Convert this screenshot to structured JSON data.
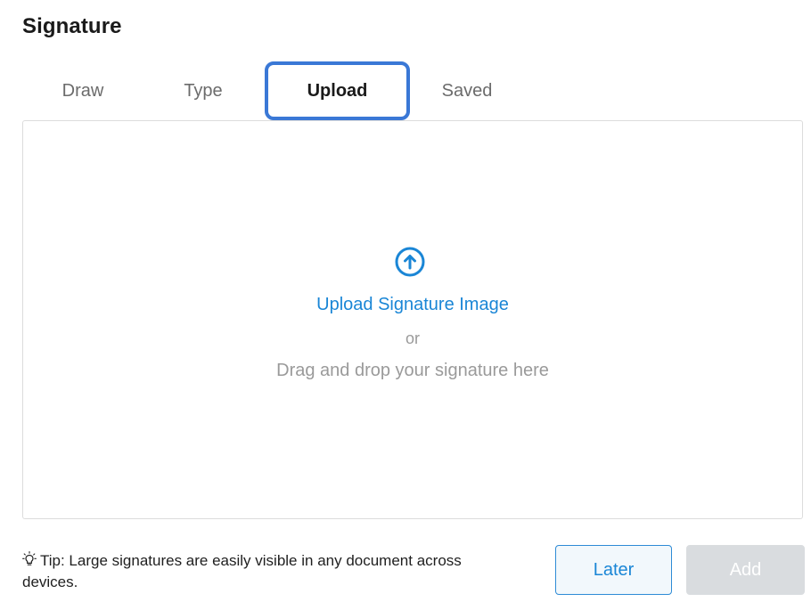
{
  "dialog": {
    "title": "Signature"
  },
  "tabs": [
    {
      "label": "Draw",
      "active": false
    },
    {
      "label": "Type",
      "active": false
    },
    {
      "label": "Upload",
      "active": true
    },
    {
      "label": "Saved",
      "active": false
    }
  ],
  "upload_area": {
    "icon": "upload-arrow-circle-icon",
    "link_label": "Upload Signature Image",
    "or_label": "or",
    "drag_label": "Drag and drop your signature here"
  },
  "footer": {
    "tip_icon": "lightbulb-icon",
    "tip_text": "Tip: Large signatures are easily visible in any document across devices.",
    "later_label": "Later",
    "add_label": "Add"
  },
  "colors": {
    "accent": "#1a86d6",
    "focus_ring": "#3a78d6",
    "disabled_button": "#d9dcdf"
  }
}
